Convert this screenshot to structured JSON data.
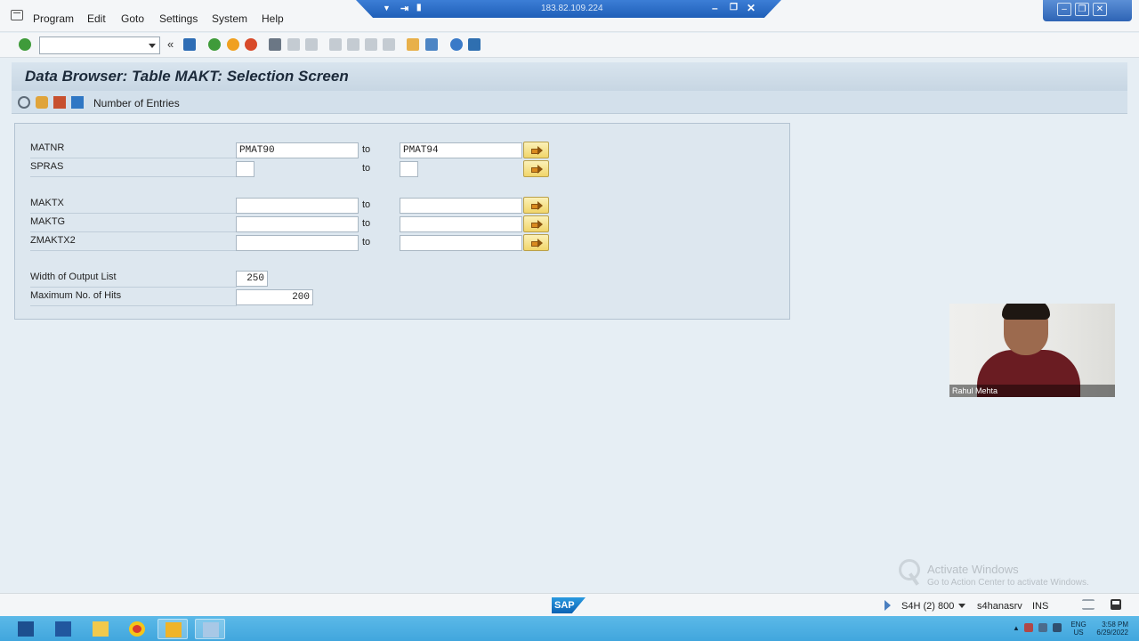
{
  "menu": {
    "items": [
      "Program",
      "Edit",
      "Goto",
      "Settings",
      "System",
      "Help"
    ]
  },
  "rdp": {
    "ip": "183.82.109.224"
  },
  "toolbar": {
    "command_field_value": "",
    "back_glyph": "«"
  },
  "page": {
    "title": "Data Browser: Table MAKT: Selection Screen",
    "app_toolbar_label": "Number of Entries"
  },
  "selection": {
    "to_label": "to",
    "rows": [
      {
        "label": "MATNR",
        "from": "PMAT90",
        "to": "PMAT94"
      },
      {
        "label": "SPRAS",
        "from": "",
        "to": ""
      },
      {
        "label": "MAKTX",
        "from": "",
        "to": ""
      },
      {
        "label": "MAKTG",
        "from": "",
        "to": ""
      },
      {
        "label": "ZMAKTX2",
        "from": "",
        "to": ""
      }
    ],
    "width_label": "Width of Output List",
    "width_value": "250",
    "max_hits_label": "Maximum No. of Hits",
    "max_hits_value": "200"
  },
  "video": {
    "name": "Rahul Mehta"
  },
  "watermark": {
    "line1": "Activate Windows",
    "line2": "Go to Action Center to activate Windows."
  },
  "status": {
    "logo": "SAP",
    "system": "S4H (2) 800",
    "server": "s4hanasrv",
    "mode": "INS"
  },
  "tray": {
    "lang1": "ENG",
    "lang2": "US",
    "time": "3:58 PM",
    "date": "6/29/2022"
  },
  "colors": {
    "accent": "#1f5fb8",
    "help_button": "#f1d56a",
    "taskbar": "#41a6dd"
  }
}
